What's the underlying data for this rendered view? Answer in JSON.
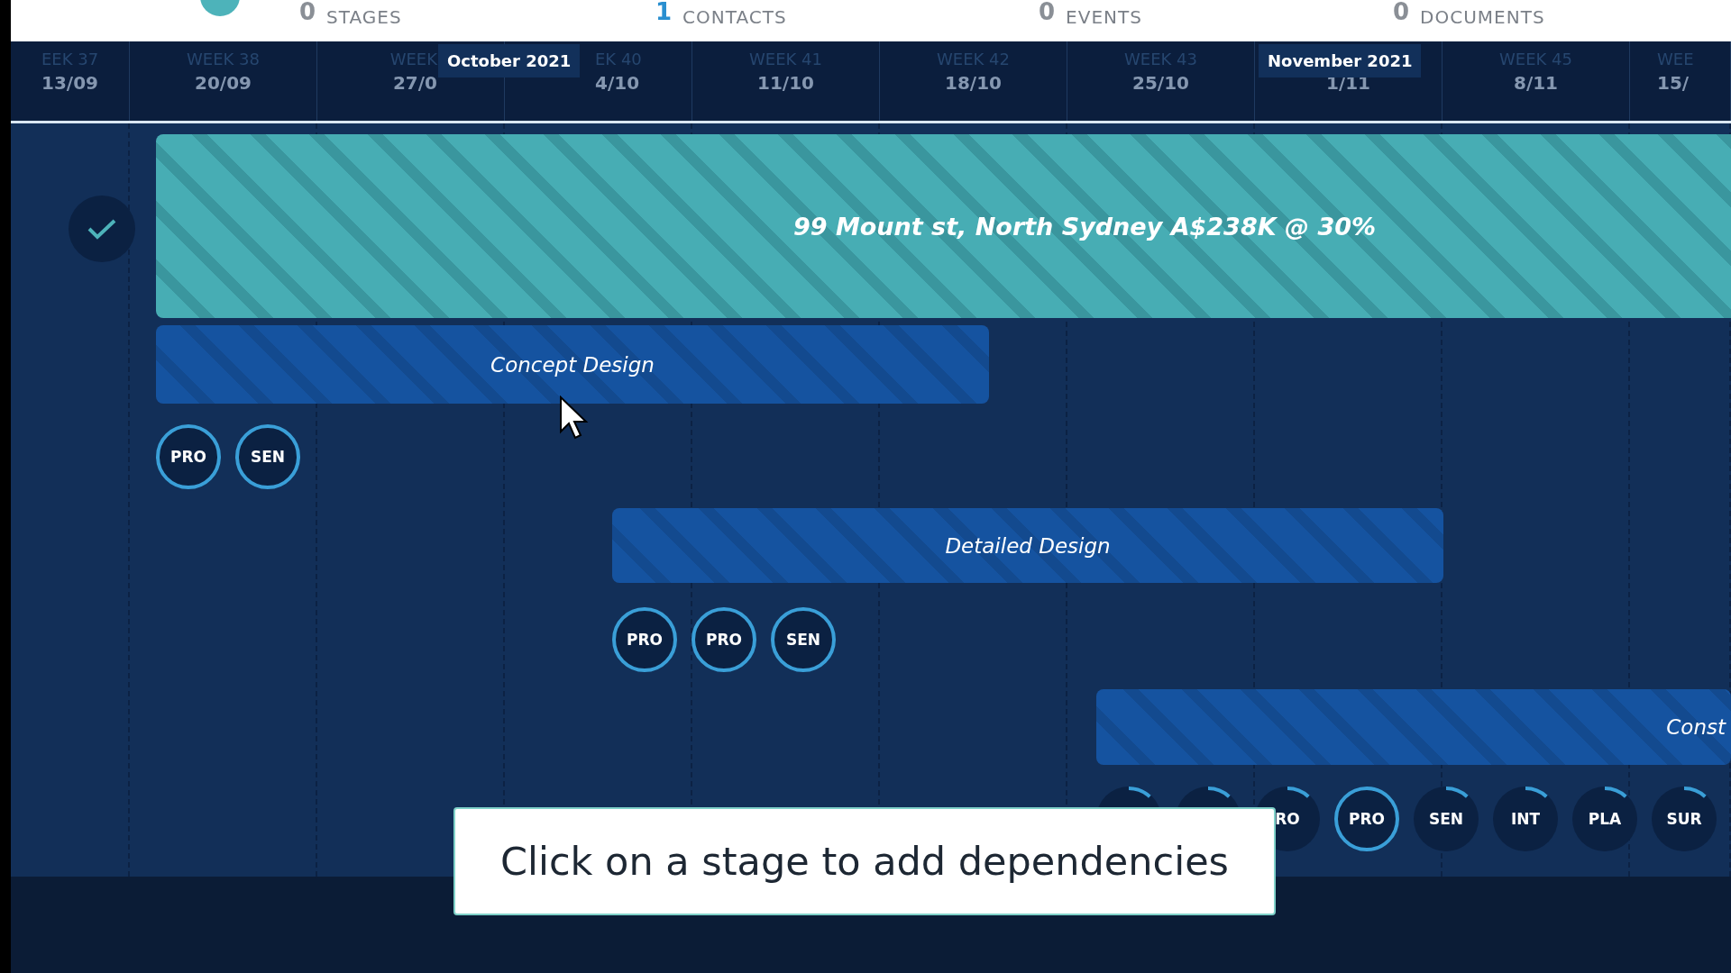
{
  "tabs": [
    {
      "count": "0",
      "label": "STAGES"
    },
    {
      "count": "1",
      "label": "CONTACTS"
    },
    {
      "count": "0",
      "label": "EVENTS"
    },
    {
      "count": "0",
      "label": "DOCUMENTS"
    }
  ],
  "timeline": {
    "weeks": [
      {
        "week": "EEK 37",
        "date": "13/09"
      },
      {
        "week": "WEEK 38",
        "date": "20/09"
      },
      {
        "week": "WEEK",
        "date": "27/0"
      },
      {
        "week": "EK 40",
        "date": "4/10"
      },
      {
        "week": "WEEK 41",
        "date": "11/10"
      },
      {
        "week": "WEEK 42",
        "date": "18/10"
      },
      {
        "week": "WEEK 43",
        "date": "25/10"
      },
      {
        "date": "1/11"
      },
      {
        "week": "WEEK 45",
        "date": "8/11"
      },
      {
        "week": "WEE",
        "date": "15/"
      }
    ],
    "months": [
      "October 2021",
      "November 2021"
    ]
  },
  "project": {
    "title": "99 Mount st, North Sydney A$238K @ 30%",
    "done": true
  },
  "stages": [
    {
      "name": "Concept Design",
      "people": [
        {
          "label": "PRO",
          "outlined": true
        },
        {
          "label": "SEN",
          "outlined": true
        }
      ]
    },
    {
      "name": "Detailed Design",
      "people": [
        {
          "label": "PRO",
          "outlined": true
        },
        {
          "label": "PRO",
          "outlined": true
        },
        {
          "label": "SEN",
          "outlined": true
        }
      ]
    },
    {
      "name": "Const",
      "people": [
        {
          "outlined": false
        },
        {
          "outlined": false
        },
        {
          "label": "RO",
          "outlined": false
        },
        {
          "label": "PRO",
          "outlined": true
        },
        {
          "label": "SEN",
          "outlined": false
        },
        {
          "label": "INT",
          "outlined": false
        },
        {
          "label": "PLA",
          "outlined": false
        },
        {
          "label": "SUR",
          "outlined": false
        }
      ]
    }
  ],
  "tooltip": "Click on a stage to add dependencies"
}
